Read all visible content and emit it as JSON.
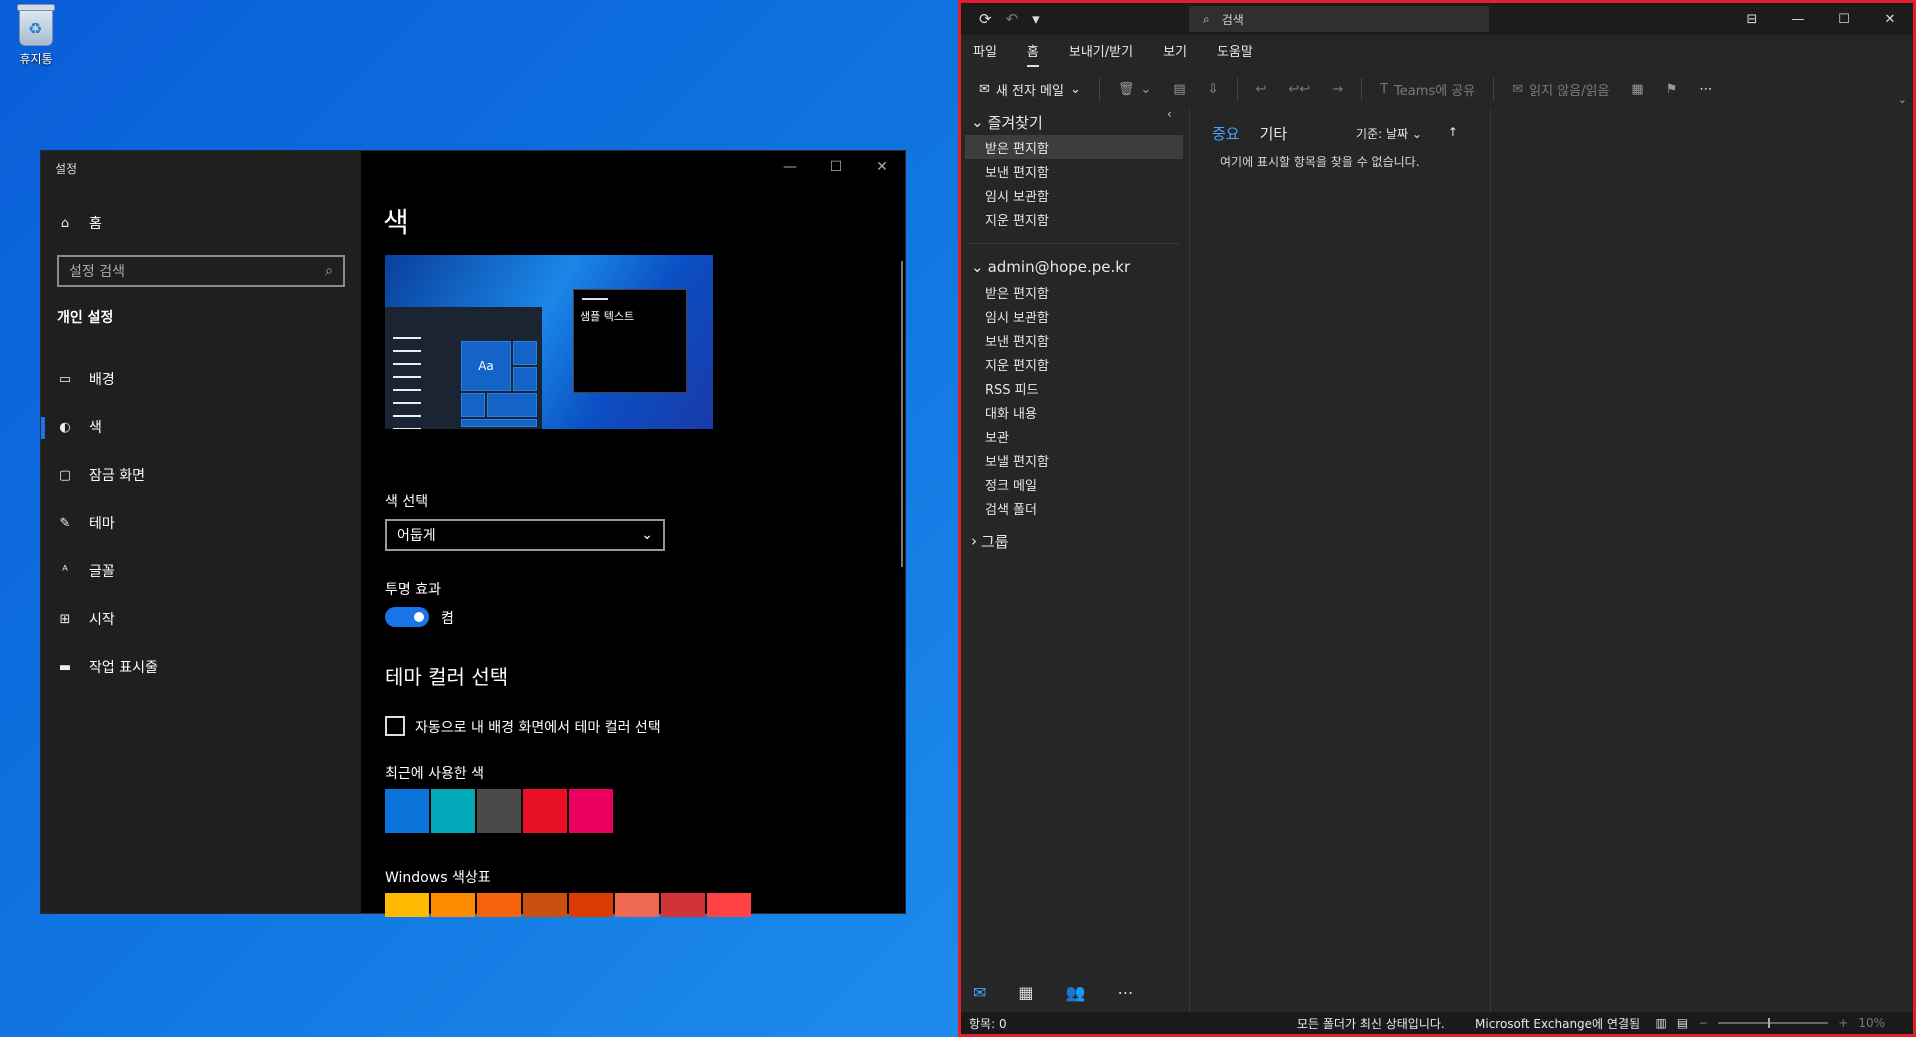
{
  "desktop": {
    "recycle_label": "휴지통"
  },
  "settings": {
    "window_title": "설정",
    "home_label": "홈",
    "search_placeholder": "설정 검색",
    "section_title": "개인 설정",
    "nav_items": [
      {
        "label": "배경",
        "icon": "image-icon"
      },
      {
        "label": "색",
        "icon": "palette-icon"
      },
      {
        "label": "잠금 화면",
        "icon": "lock-screen-icon"
      },
      {
        "label": "테마",
        "icon": "theme-icon"
      },
      {
        "label": "글꼴",
        "icon": "font-icon"
      },
      {
        "label": "시작",
        "icon": "start-icon"
      },
      {
        "label": "작업 표시줄",
        "icon": "taskbar-icon"
      }
    ],
    "page_title": "색",
    "preview_text": "샘플 텍스트",
    "preview_tile_label": "Aa",
    "choose_color_label": "색 선택",
    "choose_color_value": "어둡게",
    "transparency_label": "투명 효과",
    "transparency_state": "켬",
    "accent_heading": "테마 컬러 선택",
    "auto_accent_label": "자동으로 내 배경 화면에서 테마 컬러 선택",
    "recent_colors_label": "최근에 사용한 색",
    "recent_colors": [
      "#0a74da",
      "#00a8b8",
      "#4a4a4a",
      "#e81123",
      "#ea005e"
    ],
    "windows_colors_label": "Windows 색상표",
    "windows_colors": [
      "#ffb900",
      "#ff8c00",
      "#f7630c",
      "#ca5010",
      "#da3b01",
      "#ef6950",
      "#d13438",
      "#ff4343"
    ]
  },
  "outlook": {
    "search_placeholder": "검색",
    "tabs": [
      "파일",
      "홈",
      "보내기/받기",
      "보기",
      "도움말"
    ],
    "active_tab": "홈",
    "ribbon": {
      "new_mail": "새 전자 메일",
      "teams_share": "Teams에 공유",
      "read_unread": "읽지 않음/읽음"
    },
    "favorites_header": "즐겨찾기",
    "favorites": [
      "받은 편지함",
      "보낸 편지함",
      "임시 보관함",
      "지운 편지함"
    ],
    "account_header": "admin@hope.pe.kr",
    "account_folders": [
      "받은 편지함",
      "임시 보관함",
      "보낸 편지함",
      "지운 편지함",
      "RSS 피드",
      "대화 내용",
      "보관",
      "보낼 편지함",
      "정크 메일",
      "검색 폴더"
    ],
    "groups_header": "그룹",
    "list_tab_focused": "중요",
    "list_tab_other": "기타",
    "sort_label": "기준: 날짜",
    "empty_message": "여기에 표시할 항목을 찾을 수 없습니다.",
    "status_items": "항목: 0",
    "status_folders": "모든 폴더가 최신 상태입니다.",
    "status_connection": "Microsoft Exchange에 연결됨",
    "zoom": "10%"
  }
}
